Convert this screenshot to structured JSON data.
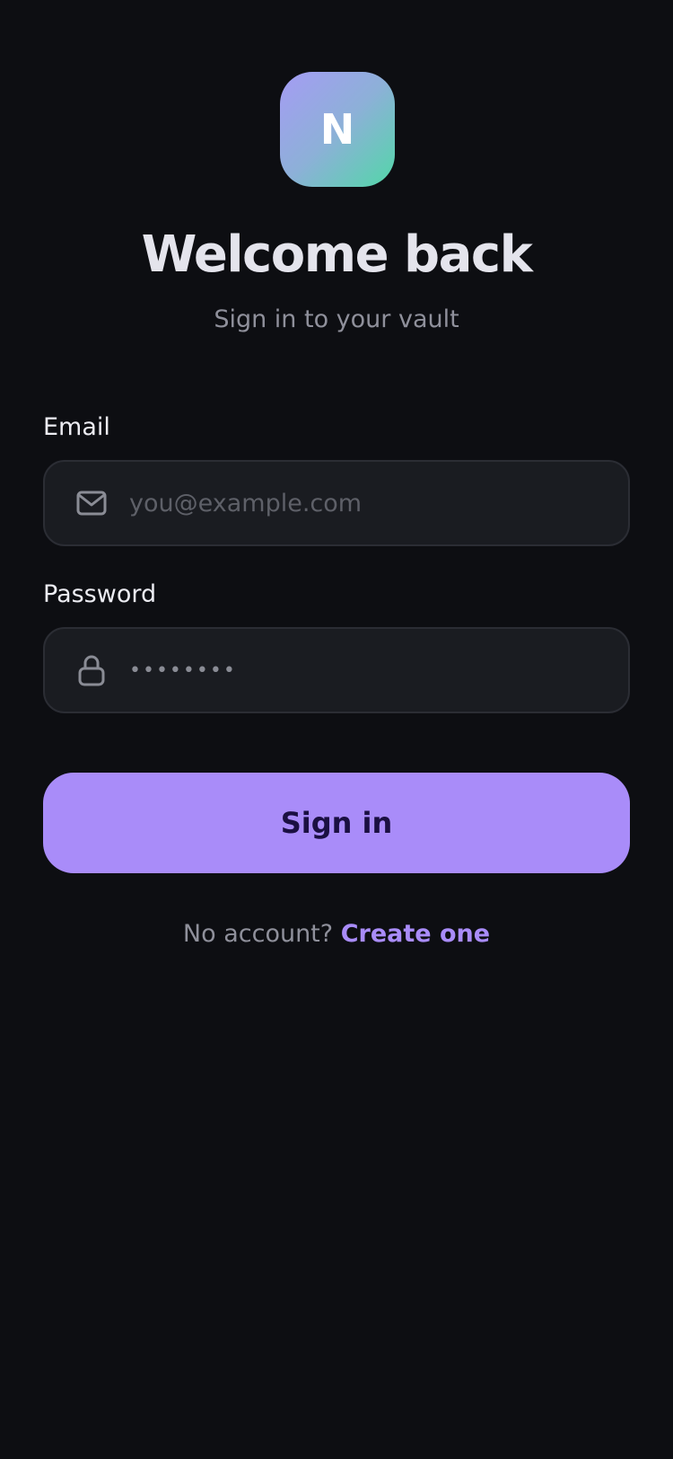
{
  "brand": {
    "logo_letter": "N",
    "accent_color": "#a98cf9",
    "gradient": [
      "#a59cf4",
      "#52d7a8"
    ]
  },
  "header": {
    "title": "Welcome back",
    "subtitle": "Sign in to your vault"
  },
  "form": {
    "email": {
      "label": "Email",
      "placeholder": "you@example.com",
      "value": "",
      "icon": "mail-icon"
    },
    "password": {
      "label": "Password",
      "masked_value": "••••••••",
      "icon": "lock-icon"
    },
    "submit_label": "Sign in"
  },
  "footer": {
    "prompt": "No account?",
    "link_label": "Create one"
  }
}
